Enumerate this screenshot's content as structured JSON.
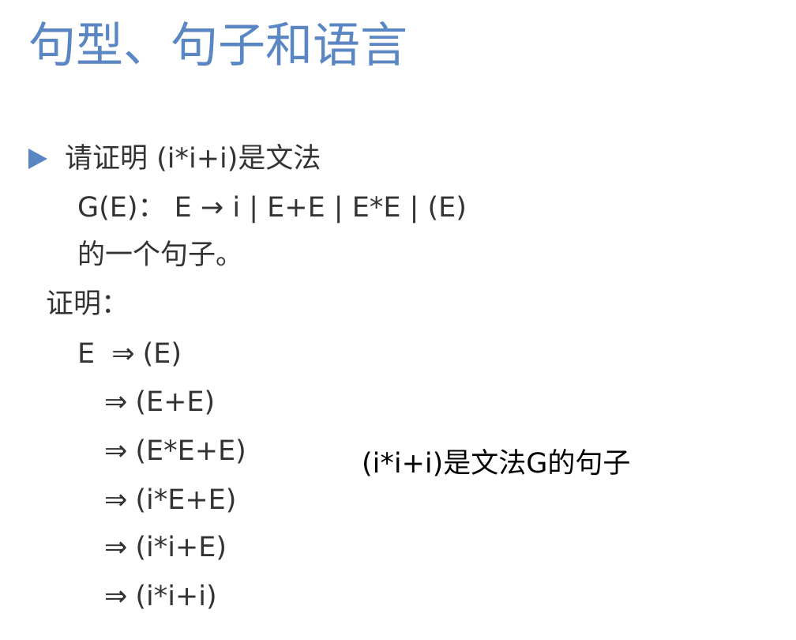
{
  "slide": {
    "title": "句型、句子和语言",
    "bullet_icon": "triangle-right-icon",
    "accent_color": "#5a86c4",
    "question": {
      "line1": "请证明 (i*i+i)是文法",
      "line2": "G(E)：  E → i | E+E | E*E | (E)",
      "line3": "的一个句子。"
    },
    "proof_label": "证明：",
    "derivation": {
      "start": "E",
      "arrow": "⇒",
      "steps": [
        "(E)",
        "(E+E)",
        "(E*E+E)",
        "(i*E+E)",
        "(i*i+E)",
        "(i*i+i)"
      ]
    },
    "conclusion": "(i*i+i)是文法G的句子"
  }
}
